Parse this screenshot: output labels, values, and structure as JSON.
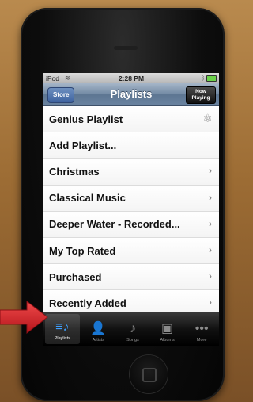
{
  "status_bar": {
    "carrier": "iPod",
    "wifi_icon": "wifi-icon",
    "time": "2:28 PM",
    "bluetooth_icon": "bluetooth-icon",
    "battery_icon": "battery-icon"
  },
  "nav": {
    "store_label": "Store",
    "title": "Playlists",
    "now_playing_line1": "Now",
    "now_playing_line2": "Playing"
  },
  "playlists": [
    {
      "label": "Genius Playlist",
      "icon": "genius-icon"
    },
    {
      "label": "Add Playlist...",
      "icon": ""
    },
    {
      "label": "Christmas",
      "icon": "chevron-right-icon"
    },
    {
      "label": "Classical Music",
      "icon": "chevron-right-icon"
    },
    {
      "label": "Deeper Water - Recorded...",
      "icon": "chevron-right-icon"
    },
    {
      "label": "My Top Rated",
      "icon": "chevron-right-icon"
    },
    {
      "label": "Purchased",
      "icon": "chevron-right-icon"
    },
    {
      "label": "Recently Added",
      "icon": "chevron-right-icon"
    }
  ],
  "tabs": [
    {
      "label": "Playlists",
      "icon": "playlists-icon",
      "active": true
    },
    {
      "label": "Artists",
      "icon": "artists-icon",
      "active": false
    },
    {
      "label": "Songs",
      "icon": "songs-icon",
      "active": false
    },
    {
      "label": "Albums",
      "icon": "albums-icon",
      "active": false
    },
    {
      "label": "More",
      "icon": "more-icon",
      "active": false
    }
  ],
  "colors": {
    "accent": "#3ea0ff",
    "arrow": "#d8232a",
    "nav_bar": "#6a83a0"
  }
}
